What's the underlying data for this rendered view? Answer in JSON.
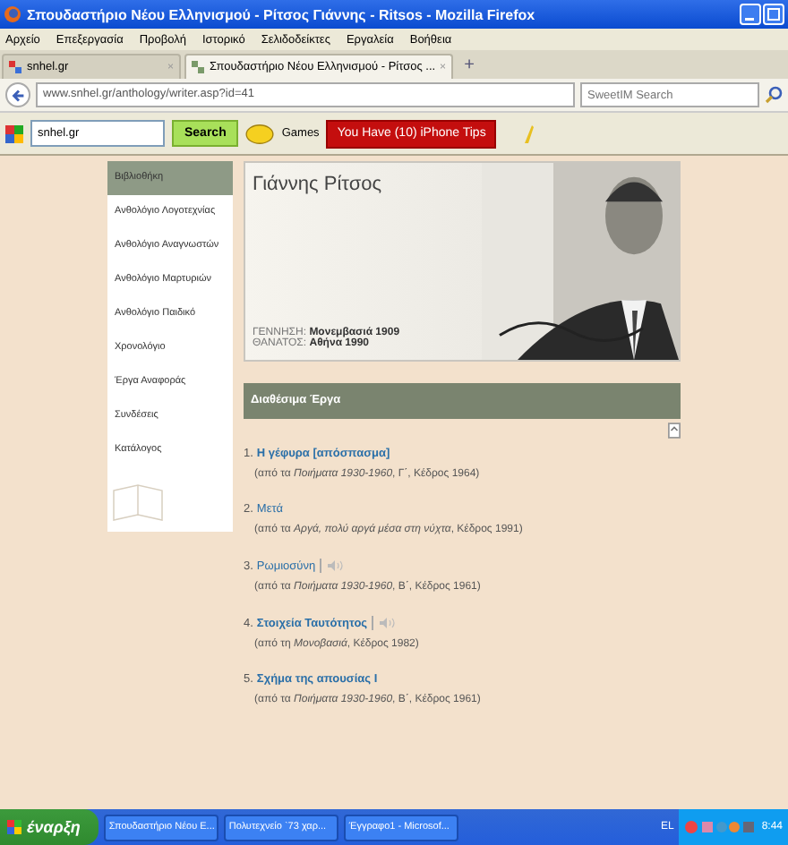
{
  "window": {
    "title": "Σπουδαστήριο Νέου Ελληνισμού - Ρίτσος Γιάννης - Ritsos - Mozilla Firefox"
  },
  "menu": [
    "Αρχείο",
    "Επεξεργασία",
    "Προβολή",
    "Ιστορικό",
    "Σελιδοδείκτες",
    "Εργαλεία",
    "Βοήθεια"
  ],
  "tabs": [
    {
      "label": "snhel.gr",
      "selected": false,
      "close": "×"
    },
    {
      "label": "Σπουδαστήριο Νέου Ελληνισμού - Ρίτσος ...",
      "selected": true,
      "close": "×"
    }
  ],
  "new_tab": "+",
  "address": "www.snhel.gr/anthology/writer.asp?id=41",
  "search": {
    "placeholder": "SweetIM Search"
  },
  "toolbar": {
    "site": "snhel.gr",
    "search_button": "Search",
    "games": "Games",
    "promo": "You Have (10) iPhone Tips"
  },
  "sidebar": {
    "items": [
      {
        "label": "Βιβλιοθήκη",
        "selected": true
      },
      {
        "label": "Ανθολόγιο Λογοτεχνίας",
        "selected": false
      },
      {
        "label": "Ανθολόγιο Αναγνωστών",
        "selected": false
      },
      {
        "label": "Ανθολόγιο Μαρτυριών",
        "selected": false
      },
      {
        "label": "Ανθολόγιο Παιδικό",
        "selected": false
      },
      {
        "label": "Χρονολόγιο",
        "selected": false
      },
      {
        "label": "Έργα Αναφοράς",
        "selected": false
      },
      {
        "label": "Συνδέσεις",
        "selected": false
      },
      {
        "label": "Κατάλογος",
        "selected": false
      }
    ]
  },
  "author": {
    "name": "Γιάννης Ρίτσος",
    "facts": [
      {
        "label": "ΓΕΝΝΗΣΗ:",
        "value": "Μονεμβασιά 1909"
      },
      {
        "label": "ΘΑΝΑΤΟΣ:",
        "value": "Αθήνα 1990"
      }
    ]
  },
  "works": {
    "heading": "Διαθέσιμα Έργα",
    "items": [
      {
        "number": "1.",
        "title": "Η γέφυρα [απόσπασμα]",
        "bold": true,
        "audio": false,
        "source": "(από τα *Ποιήματα 1930-1960*, Γ΄, Κέδρος 1964)"
      },
      {
        "number": "2.",
        "title": "Μετά",
        "bold": false,
        "audio": false,
        "source": "(από τα *Αργά, πολύ αργά μέσα στη νύχτα*, Κέδρος 1991)"
      },
      {
        "number": "3.",
        "title": "Ρωμιοσύνη",
        "bold": false,
        "audio": true,
        "source": "(από τα *Ποιήματα 1930-1960*, Β΄, Κέδρος 1961)"
      },
      {
        "number": "4.",
        "title": "Στοιχεία Ταυτότητος",
        "bold": true,
        "audio": true,
        "source": "(από τη *Μονοβασιά*, Κέδρος 1982)"
      },
      {
        "number": "5.",
        "title": "Σχήμα της απουσίας Ι",
        "bold": true,
        "audio": false,
        "source": "(από τα *Ποιήματα 1930-1960*, Β΄, Κέδρος 1961)"
      }
    ]
  },
  "taskbar": {
    "start": "έναρξη",
    "buttons": [
      "Σπουδαστήριο Νέου Ε...",
      "Πολυτεχνείο `73 χαρ...",
      "Έγγραφο1 - Microsof..."
    ],
    "language": "EL",
    "clock": "8:44"
  }
}
